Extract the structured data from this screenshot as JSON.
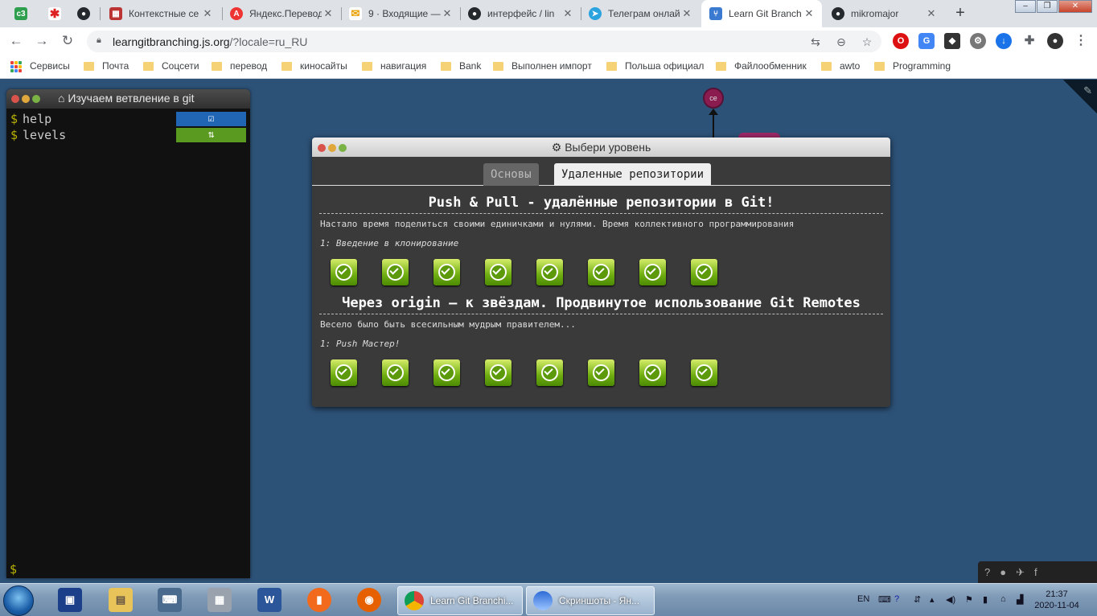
{
  "browser": {
    "tabs": [
      {
        "title": "",
        "icon": "c3-icon",
        "color": "#2e9e4f"
      },
      {
        "title": "",
        "icon": "stick-figure-icon",
        "color": "#d22"
      },
      {
        "title": "",
        "icon": "github-icon",
        "color": "#24292e"
      },
      {
        "title": "Контекстные се",
        "icon": "grid-icon",
        "color": "#b33"
      },
      {
        "title": "Яндекс.Перевод",
        "icon": "yandex-translate-icon",
        "color": "#e33"
      },
      {
        "title": "9 · Входящие —",
        "icon": "mail-icon",
        "color": "#e8a000"
      },
      {
        "title": "интерфейс / lin",
        "icon": "github-icon",
        "color": "#24292e"
      },
      {
        "title": "Телеграм онлай",
        "icon": "telegram-icon",
        "color": "#2aa3df"
      },
      {
        "title": "Learn Git Branch",
        "icon": "learngit-icon",
        "color": "#3b7ad1"
      },
      {
        "title": "mikromajor",
        "icon": "github-icon",
        "color": "#24292e"
      }
    ],
    "new_tab": "+",
    "url": {
      "host": "learngitbranching.js.org",
      "path": "/?locale=ru_RU"
    },
    "bookmarks": [
      "Сервисы",
      "Почта",
      "Соцсети",
      "перевод",
      "киносайты",
      "навигация",
      "Bank",
      "Выполнен импорт",
      "Польша официал",
      "Файлообменник",
      "awto",
      "Programming"
    ]
  },
  "terminal": {
    "title": "Изучаем ветвление в git",
    "lines": [
      "help",
      "levels"
    ],
    "prompt": "$"
  },
  "graph": {
    "node_label": "ce"
  },
  "dialog": {
    "title": "Выбери уровень",
    "tabs": [
      "Основы",
      "Удаленные репозитории"
    ],
    "sections": [
      {
        "title": "Push & Pull - удалённые репозитории в Git!",
        "description": "Настало время поделиться своими единичками и нулями. Время коллективного программирования",
        "subtitle": "1: Введение в клонирование",
        "levels_completed": 8
      },
      {
        "title": "Через origin – к звёздам. Продвинутое использование Git Remotes",
        "description": "Весело было быть всесильным мудрым правителем...",
        "subtitle": "1: Push Мастер!",
        "levels_completed": 8
      }
    ]
  },
  "taskbar": {
    "tasks": [
      "Learn Git Branchi...",
      "Скриншоты - Ян..."
    ],
    "lang": "EN",
    "time": "21:37",
    "date": "2020-11-04"
  }
}
